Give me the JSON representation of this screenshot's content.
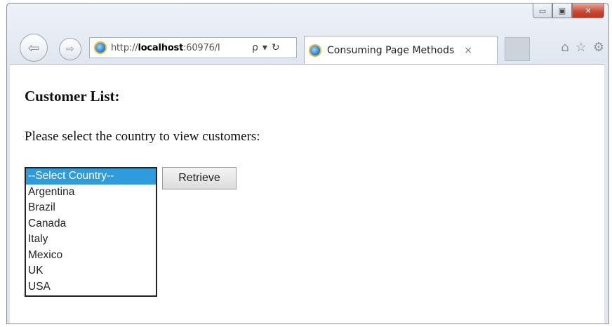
{
  "window": {
    "minimize_glyph": "▭",
    "maximize_glyph": "▣",
    "close_glyph": "✕"
  },
  "browser": {
    "back_glyph": "⇦",
    "forward_glyph": "⇨",
    "url_prefix": "http://",
    "url_host": "localhost",
    "url_rest": ":60976/I",
    "search_glyph": "ρ",
    "dropdown_glyph": "▾",
    "refresh_glyph": "↻",
    "tab_title": "Consuming Page Methods",
    "tab_close_glyph": "×",
    "home_glyph": "⌂",
    "favorites_glyph": "☆",
    "settings_glyph": "⚙"
  },
  "page": {
    "heading": "Customer List:",
    "instruction": "Please select the country to view customers:",
    "country_list": {
      "selected_index": 0,
      "options": [
        "--Select Country--",
        "Argentina",
        "Brazil",
        "Canada",
        "Italy",
        "Mexico",
        "UK",
        "USA"
      ]
    },
    "retrieve_label": "Retrieve"
  },
  "colors": {
    "selection": "#2e9bdc",
    "close_button": "#c9462f"
  }
}
